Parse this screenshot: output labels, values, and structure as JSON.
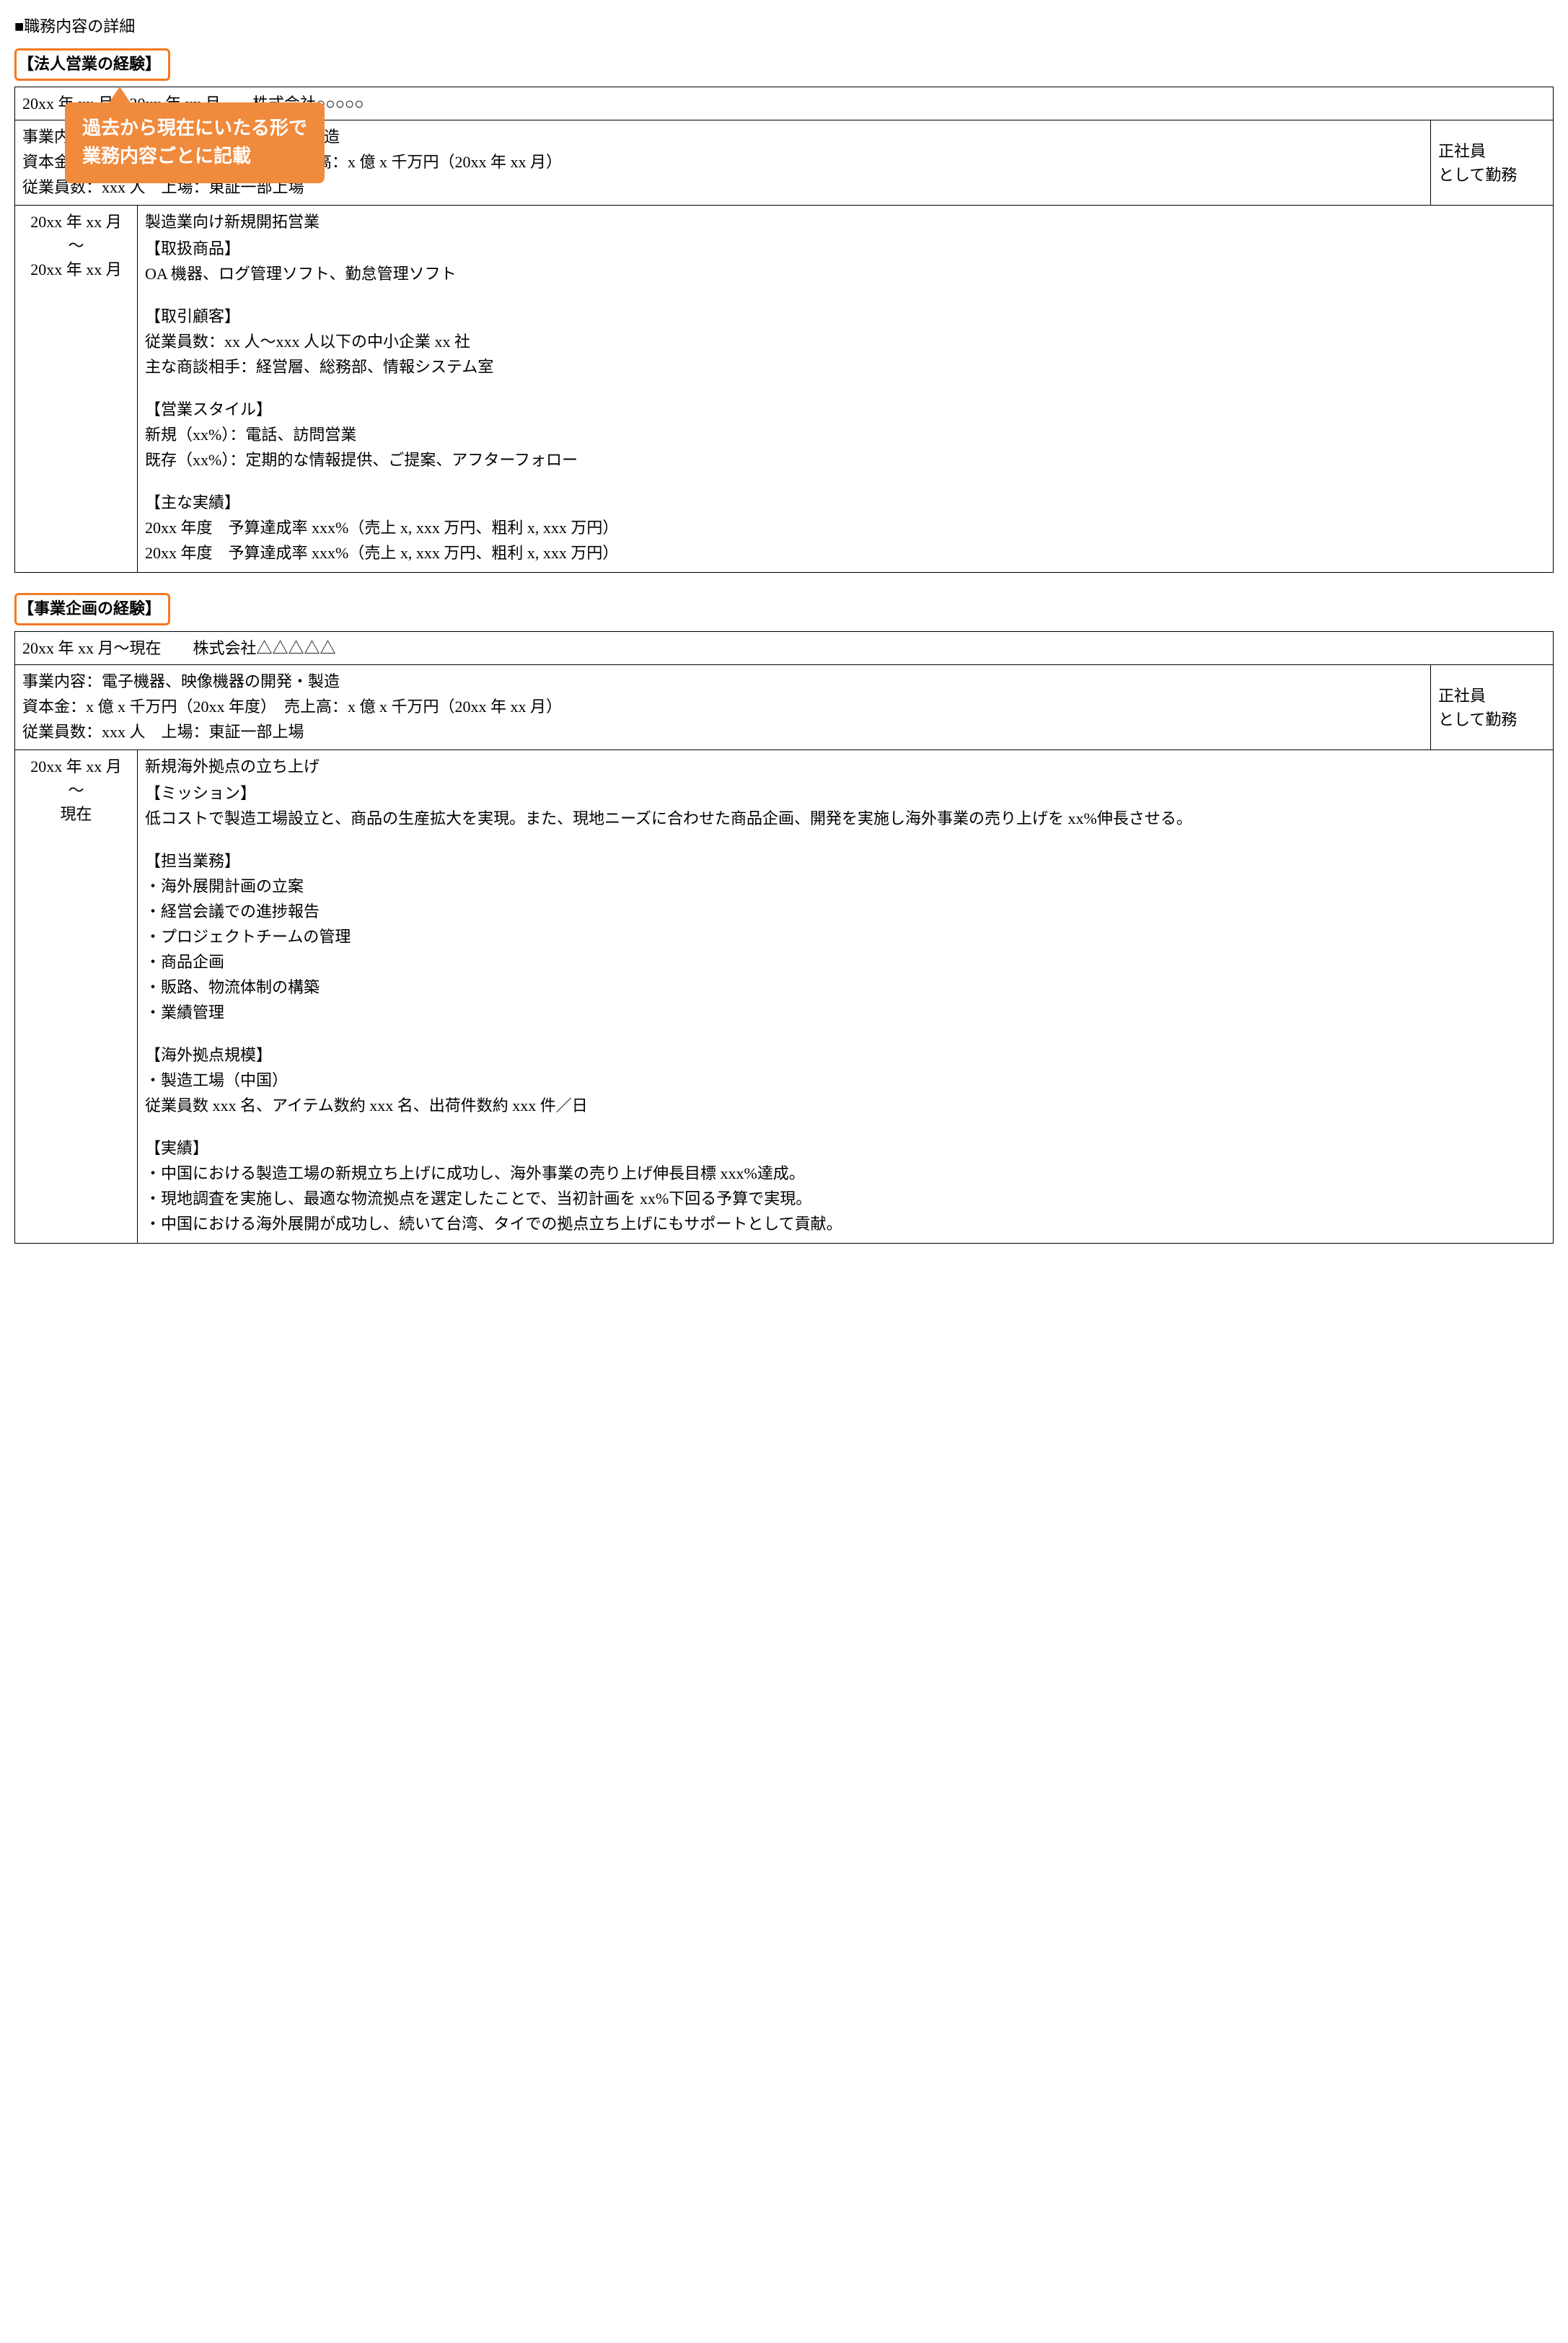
{
  "page_title": "■職務内容の詳細",
  "callout": {
    "line1": "過去から現在にいたる形で",
    "line2": "業務内容ごとに記載"
  },
  "section1": {
    "heading": "【法人営業の経験】",
    "period_company": "20xx 年 xx 月～20xx 年 xx 月　　株式会社○○○○○",
    "info_l1": "事業内容：電子機器、映像機器の開発・製造",
    "info_l2": "資本金：x 億 x 千万円（20xx 年度）　売上高：x 億 x 千万円（20xx 年 xx 月）",
    "info_l3": "従業員数：xxx 人　上場：東証一部上場",
    "emp_type_l1": "正社員",
    "emp_type_l2": "として勤務",
    "date_l1": "20xx 年 xx 月",
    "date_l2": "～",
    "date_l3": "20xx 年 xx 月",
    "role_title": "製造業向け新規開拓営業",
    "p1_h": "【取扱商品】",
    "p1_1": "OA 機器、ログ管理ソフト、勤怠管理ソフト",
    "p2_h": "【取引顧客】",
    "p2_1": "従業員数：xx 人～xxx 人以下の中小企業 xx 社",
    "p2_2": "主な商談相手：経営層、総務部、情報システム室",
    "p3_h": "【営業スタイル】",
    "p3_1": "新規（xx%）：電話、訪問営業",
    "p3_2": "既存（xx%）：定期的な情報提供、ご提案、アフターフォロー",
    "p4_h": "【主な実績】",
    "p4_1": "20xx 年度　予算達成率 xxx%（売上 x, xxx 万円、粗利 x, xxx 万円）",
    "p4_2": "20xx 年度　予算達成率 xxx%（売上 x, xxx 万円、粗利 x, xxx 万円）"
  },
  "section2": {
    "heading": "【事業企画の経験】",
    "period_company": "20xx 年 xx 月～現在　　株式会社△△△△△",
    "info_l1": "事業内容：電子機器、映像機器の開発・製造",
    "info_l2": "資本金：x 億 x 千万円（20xx 年度）　売上高：x 億 x 千万円（20xx 年 xx 月）",
    "info_l3": "従業員数：xxx 人　上場：東証一部上場",
    "emp_type_l1": "正社員",
    "emp_type_l2": "として勤務",
    "date_l1": "20xx 年 xx 月",
    "date_l2": "～",
    "date_l3": "現在",
    "role_title": "新規海外拠点の立ち上げ",
    "p1_h": "【ミッション】",
    "p1_1": "低コストで製造工場設立と、商品の生産拡大を実現。また、現地ニーズに合わせた商品企画、開発を実施し海外事業の売り上げを xx%伸長させる。",
    "p2_h": "【担当業務】",
    "p2_1": "・海外展開計画の立案",
    "p2_2": "・経営会議での進捗報告",
    "p2_3": "・プロジェクトチームの管理",
    "p2_4": "・商品企画",
    "p2_5": "・販路、物流体制の構築",
    "p2_6": "・業績管理",
    "p3_h": "【海外拠点規模】",
    "p3_1": "・製造工場（中国）",
    "p3_2": "従業員数 xxx 名、アイテム数約 xxx 名、出荷件数約 xxx 件／日",
    "p4_h": "【実績】",
    "p4_1": "・中国における製造工場の新規立ち上げに成功し、海外事業の売り上げ伸長目標 xxx%達成。",
    "p4_2": "・現地調査を実施し、最適な物流拠点を選定したことで、当初計画を xx%下回る予算で実現。",
    "p4_3": "・中国における海外展開が成功し、続いて台湾、タイでの拠点立ち上げにもサポートとして貢献。"
  }
}
